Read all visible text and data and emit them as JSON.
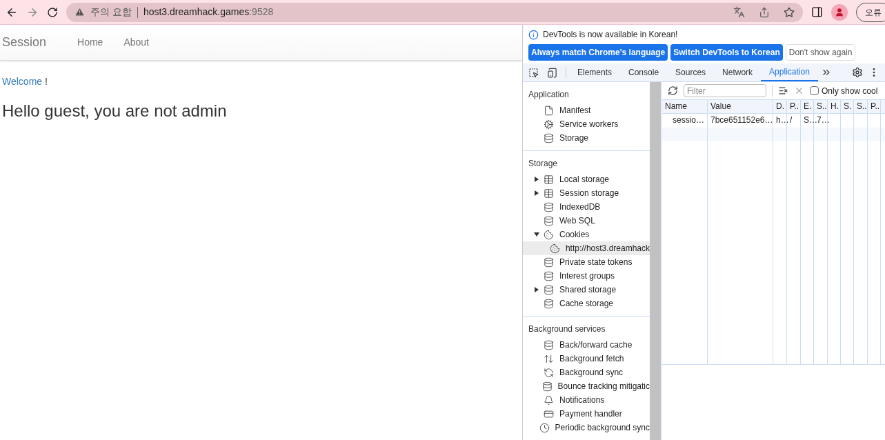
{
  "browser": {
    "warning": "주의 요함",
    "url_host": "host3.dreamhack.games",
    "url_port": ":9528",
    "error_button": "오류"
  },
  "page": {
    "brand": "Session",
    "nav": [
      {
        "label": "Home"
      },
      {
        "label": "About"
      }
    ],
    "welcome_link": "Welcome",
    "welcome_suffix": "!",
    "heading": "Hello guest, you are not admin"
  },
  "devtools": {
    "notice": "DevTools is now available in Korean!",
    "notice_buttons": [
      {
        "label": "Always match Chrome's language",
        "primary": true
      },
      {
        "label": "Switch DevTools to Korean",
        "primary": true
      },
      {
        "label": "Don't show again",
        "primary": false
      }
    ],
    "tabs": [
      {
        "label": "Elements",
        "selected": false
      },
      {
        "label": "Console",
        "selected": false
      },
      {
        "label": "Sources",
        "selected": false
      },
      {
        "label": "Network",
        "selected": false
      },
      {
        "label": "Application",
        "selected": true
      }
    ],
    "sidebar": [
      {
        "title": "Application",
        "items": [
          {
            "label": "Manifest",
            "kind": "file"
          },
          {
            "label": "Service workers",
            "kind": "gears"
          },
          {
            "label": "Storage",
            "kind": "db"
          }
        ]
      },
      {
        "title": "Storage",
        "items": [
          {
            "label": "Local storage",
            "kind": "table",
            "expanded": false
          },
          {
            "label": "Session storage",
            "kind": "table",
            "expanded": false
          },
          {
            "label": "IndexedDB",
            "kind": "db"
          },
          {
            "label": "Web SQL",
            "kind": "db"
          },
          {
            "label": "Cookies",
            "kind": "cookie",
            "expanded": true,
            "children": [
              {
                "label": "http://host3.dreamhack",
                "kind": "cookie",
                "selected": true
              }
            ]
          },
          {
            "label": "Private state tokens",
            "kind": "db"
          },
          {
            "label": "Interest groups",
            "kind": "db"
          },
          {
            "label": "Shared storage",
            "kind": "db",
            "expanded": false
          },
          {
            "label": "Cache storage",
            "kind": "db"
          }
        ]
      },
      {
        "title": "Background services",
        "items": [
          {
            "label": "Back/forward cache",
            "kind": "db"
          },
          {
            "label": "Background fetch",
            "kind": "updown"
          },
          {
            "label": "Background sync",
            "kind": "sync"
          },
          {
            "label": "Bounce tracking mitigatic",
            "kind": "db"
          },
          {
            "label": "Notifications",
            "kind": "bell"
          },
          {
            "label": "Payment handler",
            "kind": "card"
          },
          {
            "label": "Periodic background sync",
            "kind": "clock"
          }
        ]
      }
    ],
    "filter": {
      "placeholder": "Filter"
    },
    "only_show": {
      "label": "Only show cool",
      "checked": false
    },
    "cookie_table": {
      "columns": [
        "Name",
        "Value",
        "D.",
        "P..",
        "E.",
        "S..",
        "H.",
        "S.",
        "S..",
        "P.."
      ],
      "rows": [
        [
          "sessio…",
          "7bce651152e6…",
          "h…",
          "/",
          "S…",
          "7…",
          "",
          "",
          "",
          ""
        ]
      ]
    }
  }
}
